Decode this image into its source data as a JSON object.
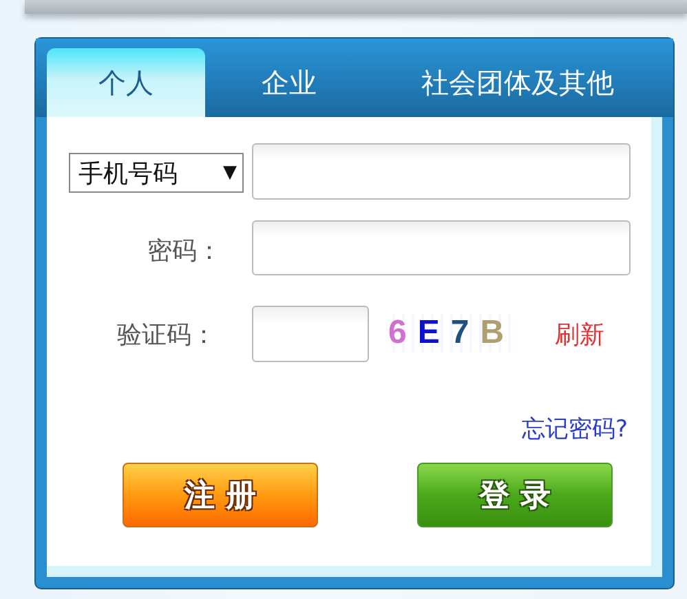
{
  "tabs": [
    {
      "label": "个人",
      "selected": true
    },
    {
      "label": "企业",
      "selected": false
    },
    {
      "label": "社会团体及其他",
      "selected": false
    }
  ],
  "form": {
    "account_type": {
      "value": "手机号码",
      "arrow": "▼"
    },
    "password_label": "密码：",
    "captcha_label": "验证码：",
    "captcha_text": "6E7B",
    "refresh_link": "刷新",
    "forgot_link": "忘记密码?"
  },
  "buttons": [
    {
      "label": "注 册",
      "kind": "register"
    },
    {
      "label": "登 录",
      "kind": "login"
    }
  ]
}
